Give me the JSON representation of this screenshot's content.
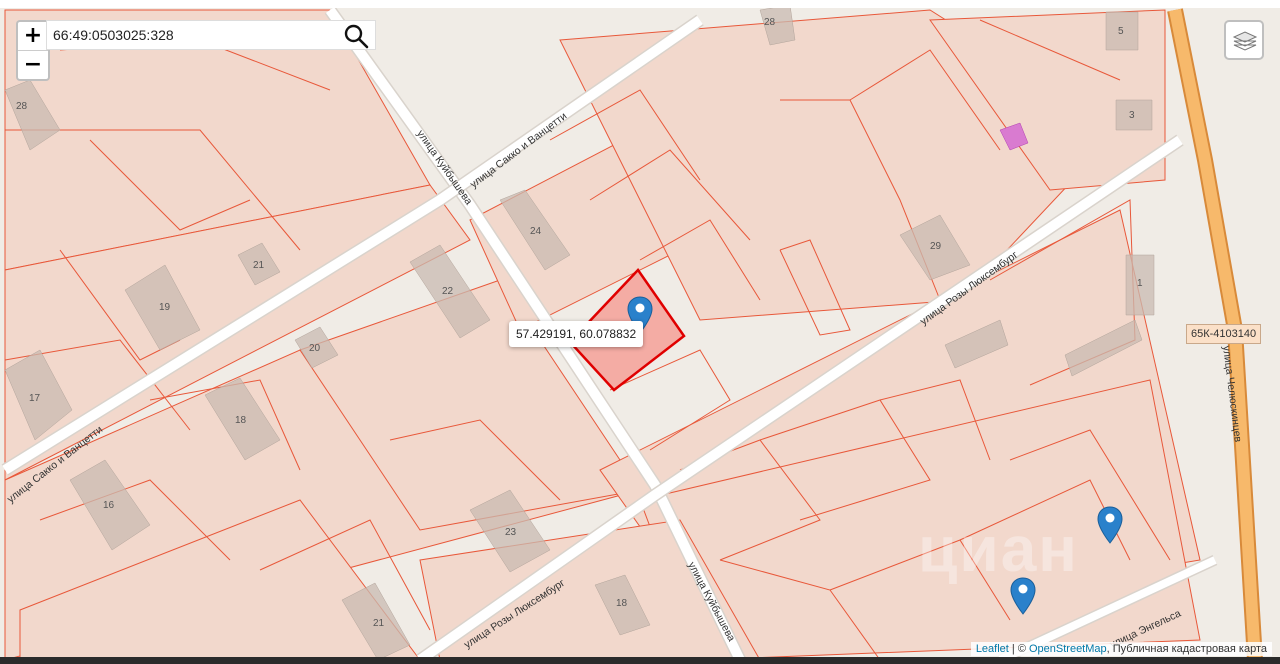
{
  "search": {
    "value": "66:49:0503025:328",
    "placeholder": ""
  },
  "zoom": {
    "in_label": "+",
    "out_label": "−"
  },
  "popup": {
    "coordinates": "57.429191, 60.078832"
  },
  "streets": {
    "sacco_upper": "улица Сакко и Ванцетти",
    "sacco_lower": "улица Сакко и Ванцетти",
    "kuibysheva_upper": "улица Куйбышева",
    "kuibysheva_lower": "улица Куйбышева",
    "rozy_upper": "улица Розы Люксембург",
    "rozy_lower": "улица Розы Люксембург",
    "chelyuskintsev": "улица Челюскинцев",
    "engelsa": "улица Энгельса"
  },
  "road_shield": "65К-4103140",
  "house_numbers": [
    "28",
    "28",
    "5",
    "3",
    "24",
    "29",
    "21",
    "22",
    "19",
    "1",
    "20",
    "17",
    "18",
    "16",
    "23",
    "18",
    "21"
  ],
  "attribution": {
    "leaflet": "Leaflet",
    "sep1": " | © ",
    "osm": "OpenStreetMap",
    "sep2": ", Публичная кадастровая карта"
  },
  "watermark": "циан",
  "colors": {
    "parcel_fill": "#f2d8cc",
    "parcel_border": "#e8583a",
    "selected_fill": "#f4a59c",
    "selected_border": "#e00000",
    "marker": "#2a81cb",
    "major_road": "#f7b96b"
  }
}
